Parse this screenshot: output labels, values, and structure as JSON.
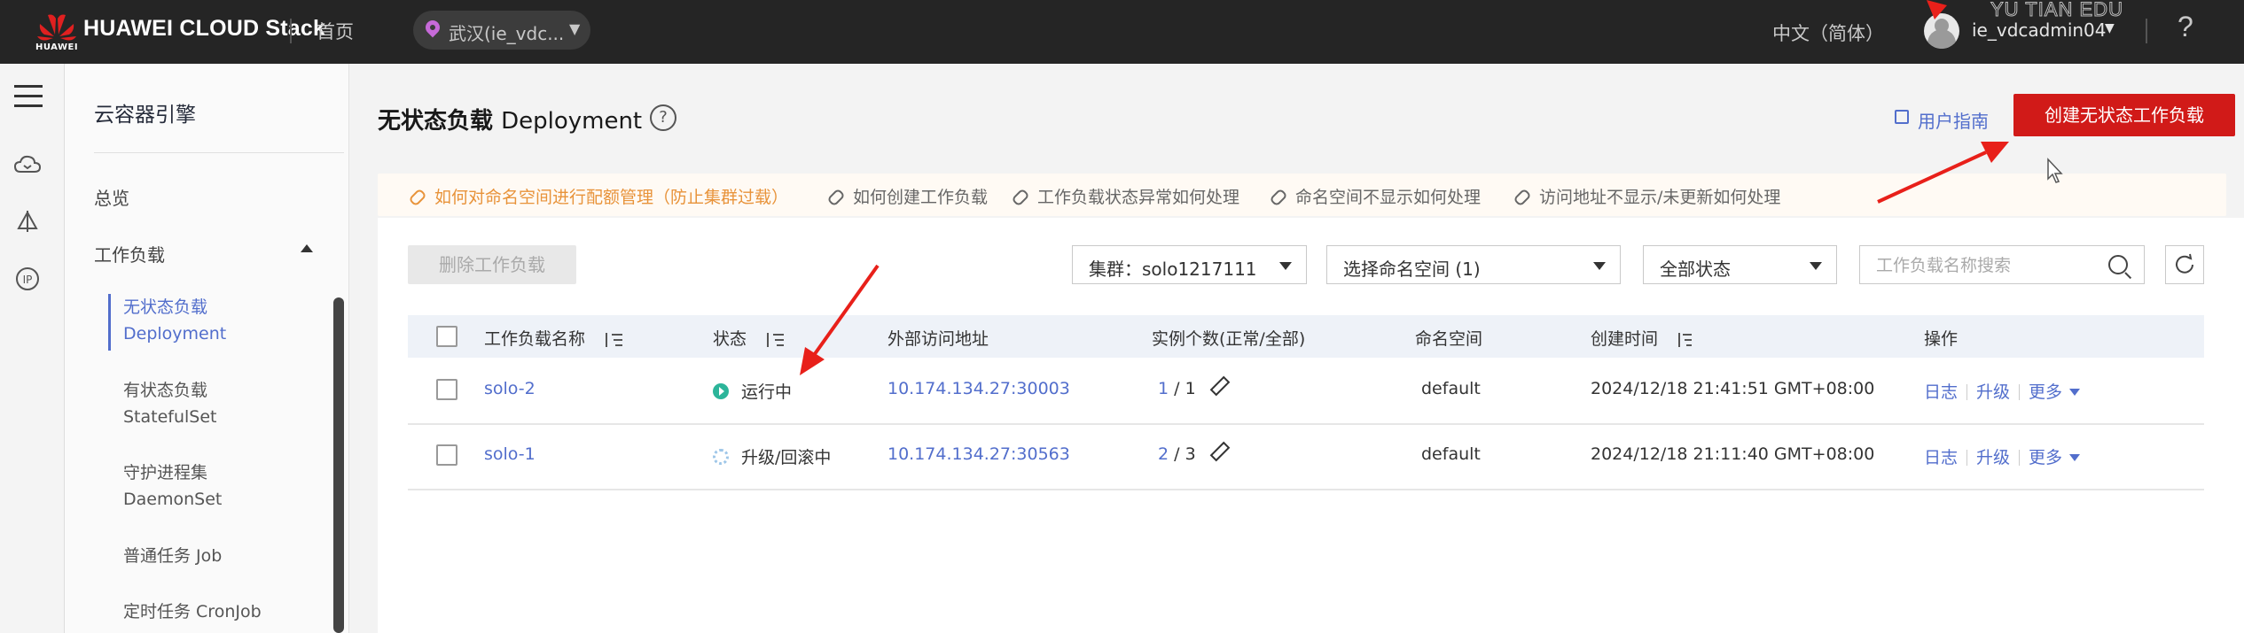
{
  "topbar": {
    "brand": "HUAWEI CLOUD Stack",
    "brand_sub": "HUAWEI",
    "home": "首页",
    "region": "武汉(ie_vdc...",
    "language": "中文（简体）",
    "username": "ie_vdcadmin04",
    "help_glyph": "?",
    "watermark": "YU TIAN EDU"
  },
  "sidebar": {
    "title": "云容器引擎",
    "overview": "总览",
    "workloads": "工作负载",
    "items": [
      {
        "cn": "无状态负载",
        "en": "Deployment",
        "active": true
      },
      {
        "cn": "有状态负载",
        "en": "StatefulSet"
      },
      {
        "cn": "守护进程集",
        "en": "DaemonSet"
      },
      {
        "cn": "普通任务 Job"
      },
      {
        "cn": "定时任务 CronJob"
      }
    ]
  },
  "page": {
    "title_cn": "无状态负载",
    "title_en": "Deployment",
    "user_guide": "用户指南",
    "create_button": "创建无状态工作负载"
  },
  "tips": [
    "如何对命名空间进行配额管理（防止集群过载）",
    "如何创建工作负载",
    "工作负载状态异常如何处理",
    "命名空间不显示如何处理",
    "访问地址不显示/未更新如何处理"
  ],
  "toolbar": {
    "delete_button": "删除工作负载",
    "cluster_select": "集群：solo1217111",
    "namespace_select": "选择命名空间 (1)",
    "status_select": "全部状态",
    "search_placeholder": "工作负载名称搜索"
  },
  "table": {
    "headers": {
      "name": "工作负载名称",
      "status": "状态",
      "address": "外部访问地址",
      "instances": "实例个数(正常/全部)",
      "namespace": "命名空间",
      "created": "创建时间",
      "actions": "操作"
    },
    "rows": [
      {
        "name": "solo-2",
        "status": "运行中",
        "address": "10.174.134.27:30003",
        "normal": "1",
        "total": "/ 1",
        "namespace": "default",
        "created": "2024/12/18 21:41:51 GMT+08:00",
        "log": "日志",
        "upgrade": "升级",
        "more": "更多"
      },
      {
        "name": "solo-1",
        "status": "升级/回滚中",
        "address": "10.174.134.27:30563",
        "normal": "2",
        "total": "/ 3",
        "namespace": "default",
        "created": "2024/12/18 21:11:40 GMT+08:00",
        "log": "日志",
        "upgrade": "升级",
        "more": "更多"
      }
    ]
  },
  "colors": {
    "accent": "#526ecc",
    "primary_button": "#d11a18",
    "running": "#2cb59a",
    "annotation_arrow": "#e8201a"
  }
}
